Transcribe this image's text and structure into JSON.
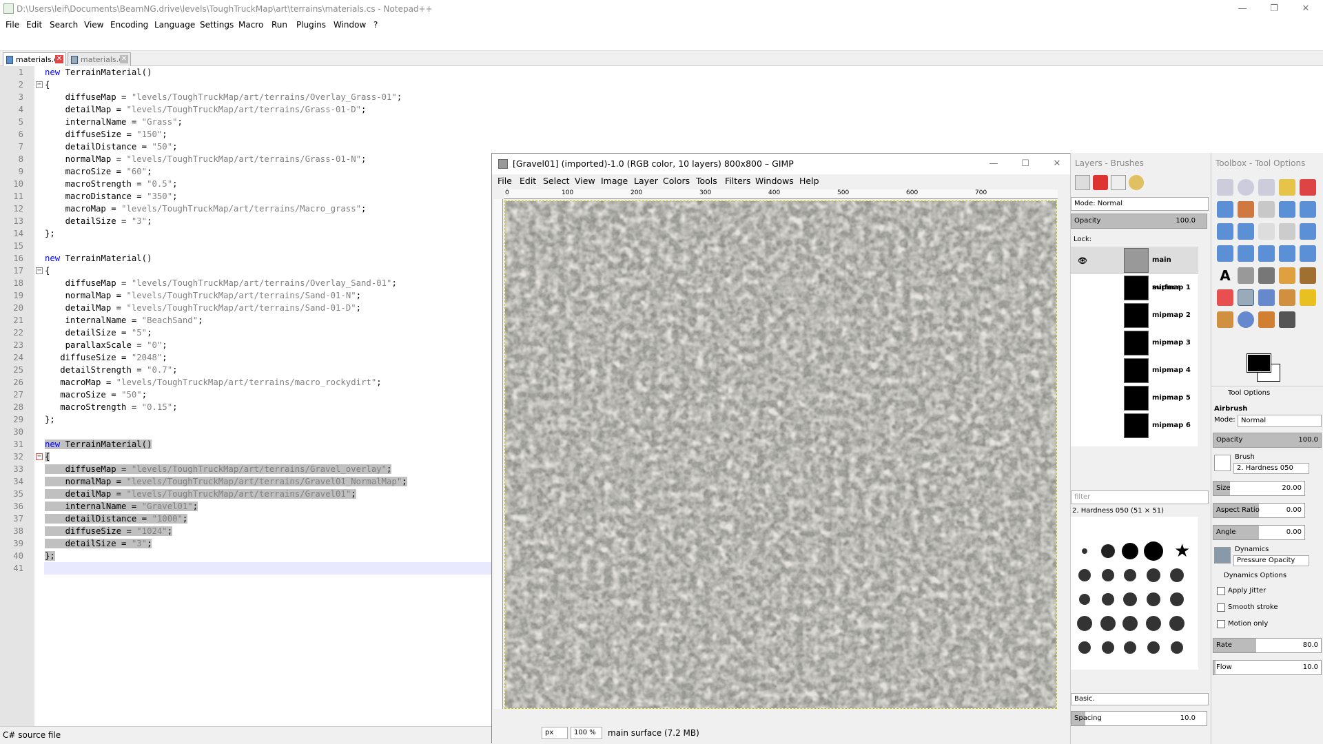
{
  "notepad": {
    "title": "D:\\Users\\leif\\Documents\\BeamNG.drive\\levels\\ToughTruckMap\\art\\terrains\\materials.cs - Notepad++",
    "menu": [
      "File",
      "Edit",
      "Search",
      "View",
      "Encoding",
      "Language",
      "Settings",
      "Macro",
      "Run",
      "Plugins",
      "Window",
      "?"
    ],
    "tabs": [
      "materials.cs",
      "materials.cs"
    ],
    "status_left": "C# source file",
    "lines": [
      [
        [
          "kw",
          "new"
        ],
        [
          "t",
          " TerrainMaterial()"
        ]
      ],
      [
        [
          "t",
          "{"
        ]
      ],
      [
        [
          "t",
          "    diffuseMap = "
        ],
        [
          "str",
          "\"levels/ToughTruckMap/art/terrains/Overlay_Grass-01\""
        ],
        [
          "t",
          ";"
        ]
      ],
      [
        [
          "t",
          "    detailMap = "
        ],
        [
          "str",
          "\"levels/ToughTruckMap/art/terrains/Grass-01-D\""
        ],
        [
          "t",
          ";"
        ]
      ],
      [
        [
          "t",
          "    internalName = "
        ],
        [
          "str",
          "\"Grass\""
        ],
        [
          "t",
          ";"
        ]
      ],
      [
        [
          "t",
          "    diffuseSize = "
        ],
        [
          "str",
          "\"150\""
        ],
        [
          "t",
          ";"
        ]
      ],
      [
        [
          "t",
          "    detailDistance = "
        ],
        [
          "str",
          "\"50\""
        ],
        [
          "t",
          ";"
        ]
      ],
      [
        [
          "t",
          "    normalMap = "
        ],
        [
          "str",
          "\"levels/ToughTruckMap/art/terrains/Grass-01-N\""
        ],
        [
          "t",
          ";"
        ]
      ],
      [
        [
          "t",
          "    macroSize = "
        ],
        [
          "str",
          "\"60\""
        ],
        [
          "t",
          ";"
        ]
      ],
      [
        [
          "t",
          "    macroStrength = "
        ],
        [
          "str",
          "\"0.5\""
        ],
        [
          "t",
          ";"
        ]
      ],
      [
        [
          "t",
          "    macroDistance = "
        ],
        [
          "str",
          "\"350\""
        ],
        [
          "t",
          ";"
        ]
      ],
      [
        [
          "t",
          "    macroMap = "
        ],
        [
          "str",
          "\"levels/ToughTruckMap/art/terrains/Macro_grass\""
        ],
        [
          "t",
          ";"
        ]
      ],
      [
        [
          "t",
          "    detailSize = "
        ],
        [
          "str",
          "\"3\""
        ],
        [
          "t",
          ";"
        ]
      ],
      [
        [
          "t",
          "};"
        ]
      ],
      [
        [
          "t",
          ""
        ]
      ],
      [
        [
          "kw",
          "new"
        ],
        [
          "t",
          " TerrainMaterial()"
        ]
      ],
      [
        [
          "t",
          "{"
        ]
      ],
      [
        [
          "t",
          "    diffuseMap = "
        ],
        [
          "str",
          "\"levels/ToughTruckMap/art/terrains/Overlay_Sand-01\""
        ],
        [
          "t",
          ";"
        ]
      ],
      [
        [
          "t",
          "    normalMap = "
        ],
        [
          "str",
          "\"levels/ToughTruckMap/art/terrains/Sand-01-N\""
        ],
        [
          "t",
          ";"
        ]
      ],
      [
        [
          "t",
          "    detailMap = "
        ],
        [
          "str",
          "\"levels/ToughTruckMap/art/terrains/Sand-01-D\""
        ],
        [
          "t",
          ";"
        ]
      ],
      [
        [
          "t",
          "    internalName = "
        ],
        [
          "str",
          "\"BeachSand\""
        ],
        [
          "t",
          ";"
        ]
      ],
      [
        [
          "t",
          "    detailSize = "
        ],
        [
          "str",
          "\"5\""
        ],
        [
          "t",
          ";"
        ]
      ],
      [
        [
          "t",
          "    parallaxScale = "
        ],
        [
          "str",
          "\"0\""
        ],
        [
          "t",
          ";"
        ]
      ],
      [
        [
          "t",
          "   diffuseSize = "
        ],
        [
          "str",
          "\"2048\""
        ],
        [
          "t",
          ";"
        ]
      ],
      [
        [
          "t",
          "   detailStrength = "
        ],
        [
          "str",
          "\"0.7\""
        ],
        [
          "t",
          ";"
        ]
      ],
      [
        [
          "t",
          "   macroMap = "
        ],
        [
          "str",
          "\"levels/ToughTruckMap/art/terrains/macro_rockydirt\""
        ],
        [
          "t",
          ";"
        ]
      ],
      [
        [
          "t",
          "   macroSize = "
        ],
        [
          "str",
          "\"50\""
        ],
        [
          "t",
          ";"
        ]
      ],
      [
        [
          "t",
          "   macroStrength = "
        ],
        [
          "str",
          "\"0.15\""
        ],
        [
          "t",
          ";"
        ]
      ],
      [
        [
          "t",
          "};"
        ]
      ],
      [
        [
          "t",
          ""
        ]
      ],
      [
        [
          "kw",
          "new"
        ],
        [
          "t",
          " TerrainMaterial()"
        ]
      ],
      [
        [
          "t",
          "{"
        ]
      ],
      [
        [
          "t",
          "    diffuseMap = "
        ],
        [
          "str",
          "\"levels/ToughTruckMap/art/terrains/Gravel_overlay\""
        ],
        [
          "t",
          ";"
        ]
      ],
      [
        [
          "t",
          "    normalMap = "
        ],
        [
          "str",
          "\"levels/ToughTruckMap/art/terrains/Gravel01_NormalMap\""
        ],
        [
          "t",
          ";"
        ]
      ],
      [
        [
          "t",
          "    detailMap = "
        ],
        [
          "str",
          "\"levels/ToughTruckMap/art/terrains/Gravel01\""
        ],
        [
          "t",
          ";"
        ]
      ],
      [
        [
          "t",
          "    internalName = "
        ],
        [
          "str",
          "\"Gravel01\""
        ],
        [
          "t",
          ";"
        ]
      ],
      [
        [
          "t",
          "    detailDistance = "
        ],
        [
          "str",
          "\"1000\""
        ],
        [
          "t",
          ";"
        ]
      ],
      [
        [
          "t",
          "    diffuseSize = "
        ],
        [
          "str",
          "\"1024\""
        ],
        [
          "t",
          ";"
        ]
      ],
      [
        [
          "t",
          "    detailSize = "
        ],
        [
          "str",
          "\"3\""
        ],
        [
          "t",
          ";"
        ]
      ],
      [
        [
          "t",
          "};"
        ]
      ],
      [
        [
          "t",
          ""
        ]
      ]
    ]
  },
  "gimp": {
    "title": "[Gravel01] (imported)-1.0 (RGB color, 10 layers) 800x800 – GIMP",
    "menu": [
      "File",
      "Edit",
      "Select",
      "View",
      "Image",
      "Layer",
      "Colors",
      "Tools",
      "Filters",
      "Windows",
      "Help"
    ],
    "ruler_marks": [
      "0",
      "100",
      "200",
      "300",
      "400",
      "500",
      "600",
      "700"
    ],
    "unit": "px",
    "zoom": "100 %",
    "status": "main surface  (7.2 MB)"
  },
  "layers_dock": {
    "title": "Layers - Brushes",
    "mode_label": "Mode: Normal",
    "opacity_label": "Opacity",
    "opacity_value": "100.0",
    "lock_label": "Lock:",
    "layers": [
      "main surface",
      "mipmap 1",
      "mipmap 2",
      "mipmap 3",
      "mipmap 4",
      "mipmap 5",
      "mipmap 6"
    ],
    "filter_placeholder": "filter",
    "brush_name": "2. Hardness 050 (51 × 51)",
    "preset": "Basic.",
    "spacing_label": "Spacing",
    "spacing_value": "10.0"
  },
  "toolbox": {
    "title": "Toolbox - Tool Options",
    "tool_options_label": "Tool Options",
    "tool_name": "Airbrush",
    "mode_label": "Mode:",
    "mode_value": "Normal",
    "opacity_label": "Opacity",
    "opacity_value": "100.0",
    "brush_label": "Brush",
    "brush_value": "2. Hardness 050",
    "size_label": "Size",
    "size_value": "20.00",
    "aspect_label": "Aspect Ratio",
    "aspect_value": "0.00",
    "angle_label": "Angle",
    "angle_value": "0.00",
    "dynamics_label": "Dynamics",
    "dynamics_value": "Pressure Opacity",
    "dynamics_options": "Dynamics Options",
    "apply_jitter": "Apply Jitter",
    "smooth_stroke": "Smooth stroke",
    "motion_only": "Motion only",
    "rate_label": "Rate",
    "rate_value": "80.0",
    "flow_label": "Flow",
    "flow_value": "10.0"
  }
}
